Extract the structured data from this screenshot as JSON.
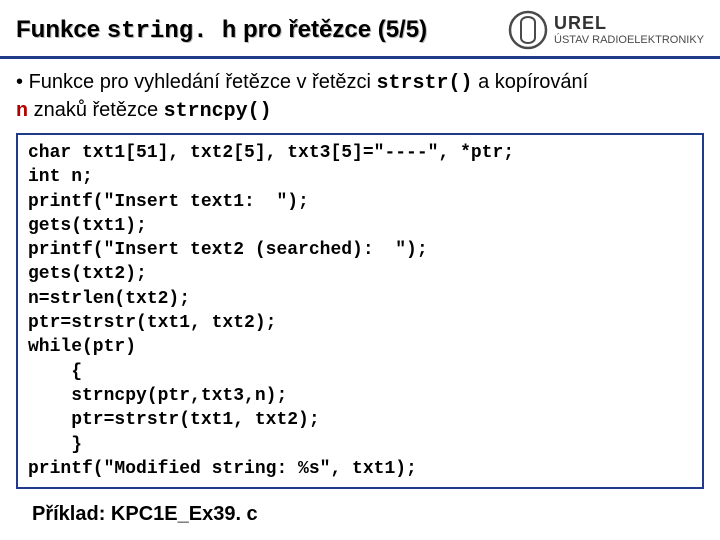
{
  "header": {
    "title_pre": "Funkce ",
    "title_mono": "string. h",
    "title_post": " pro řetězce (5/5)",
    "logo_brand": "UREL",
    "logo_sub": "ÚSTAV RADIOELEKTRONIKY"
  },
  "desc": {
    "bullet": "•",
    "line1_a": " Funkce pro vyhledání řetězce v řetězci ",
    "strstr": "strstr()",
    "line1_b": "  a kopírování",
    "n": "n",
    "line2_a": " znaků řetězce  ",
    "strncpy": "strncpy()"
  },
  "code": {
    "l1": "char txt1[51], txt2[5], txt3[5]=\"----\", *ptr;",
    "l2": "int n;",
    "l3": "printf(\"Insert text1:  \");",
    "l4": "gets(txt1);",
    "l5": "printf(\"Insert text2 (searched):  \");",
    "l6": "gets(txt2);",
    "l7": "n=strlen(txt2);",
    "l8": "ptr=strstr(txt1, txt2);",
    "l9": "while(ptr)",
    "l10": "    {",
    "l11": "    strncpy(ptr,txt3,n);",
    "l12": "    ptr=strstr(txt1, txt2);",
    "l13": "    }",
    "l14": "printf(\"Modified string: %s\", txt1);"
  },
  "footer": {
    "text": "Příklad: KPC1E_Ex39. c"
  }
}
